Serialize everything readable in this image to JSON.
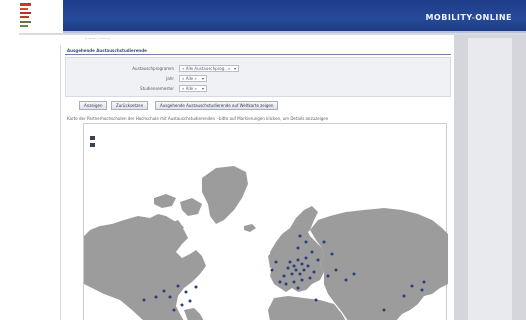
{
  "header": {
    "brand_part1": "MOBILITY",
    "brand_dash": "-",
    "brand_part2": "ONLINE",
    "breadcrumb": "·········· ·········",
    "colors": {
      "bar": "#274a9a",
      "accent": "#f0b32b"
    },
    "logo_icon": "university-logo-icon"
  },
  "main": {
    "section_title": "Ausgehende Austauschstudierende",
    "filters": [
      {
        "label": "Austauschprogramm",
        "value": "« Alle Austauschprog...»"
      },
      {
        "label": "Jahr",
        "value": "« Alle »"
      },
      {
        "label": "Studiensemester",
        "value": "« Alle »"
      }
    ],
    "buttons": [
      {
        "label": "Anzeigen"
      },
      {
        "label": "Zurücksetzen"
      },
      {
        "label": "Ausgehende Austauschstudierende auf Weltkarte zeigen"
      }
    ],
    "note": "Karte der Partnerhochschulen der Hochschule mit Austauschstudierenden - bitte auf Markierungen klicken, um Details anzuzeigen",
    "map": {
      "land_color": "#9c9c9c",
      "water_color": "#ffffff",
      "marker_color": "#2a3f7a",
      "zoom_in_icon": "zoom-in-icon",
      "zoom_out_icon": "zoom-out-icon"
    }
  }
}
